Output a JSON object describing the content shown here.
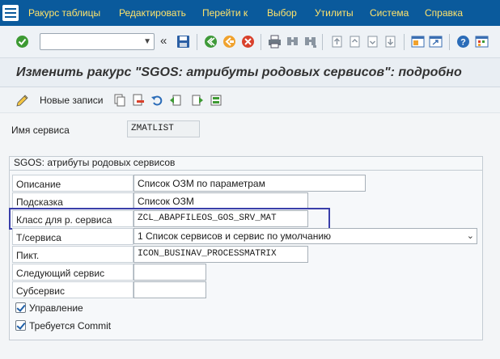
{
  "menu": {
    "items": [
      "Ракурс таблицы",
      "Редактировать",
      "Перейти к",
      "Выбор",
      "Утилиты",
      "Система",
      "Справка"
    ]
  },
  "toolbar": {
    "command_value": "",
    "icons": [
      "enter-check-icon",
      "save-icon",
      "back-icon",
      "exit-icon",
      "cancel-icon",
      "print-icon",
      "find-icon",
      "find-next-icon",
      "first-page-icon",
      "previous-page-icon",
      "next-page-icon",
      "last-page-icon",
      "new-session-icon",
      "shortcut-icon",
      "help-icon",
      "customize-icon"
    ]
  },
  "title": "Изменить ракурс \"SGOS: атрибуты родовых сервисов\": подробно",
  "app_toolbar": {
    "new_entries_label": "Новые записи"
  },
  "service_name": {
    "label": "Имя сервиса",
    "value": "ZMATLIST"
  },
  "group": {
    "title": "SGOS: атрибуты родовых сервисов",
    "description_label": "Описание",
    "description_value": "Список ОЗМ по параметрам",
    "hint_label": "Подсказка",
    "hint_value": "Список ОЗМ",
    "class_label": "Класс для р. сервиса",
    "class_value": "ZCL_ABAPFILEOS_GOS_SRV_MAT",
    "type_label": "Т/сервиса",
    "type_value": "1 Список сервисов и сервис по умолчанию",
    "icon_label": "Пикт.",
    "icon_value": "ICON_BUSINAV_PROCESSMATRIX",
    "next_label": "Следующий сервис",
    "next_value": "",
    "sub_label": "Субсервис",
    "sub_value": "",
    "control_label": "Управление",
    "control_checked": true,
    "commit_label": "Требуется Commit",
    "commit_checked": true
  },
  "colors": {
    "menubar": "#0a5a9c",
    "menu_text": "#ffe36b",
    "highlight_border": "#3a3faa"
  }
}
